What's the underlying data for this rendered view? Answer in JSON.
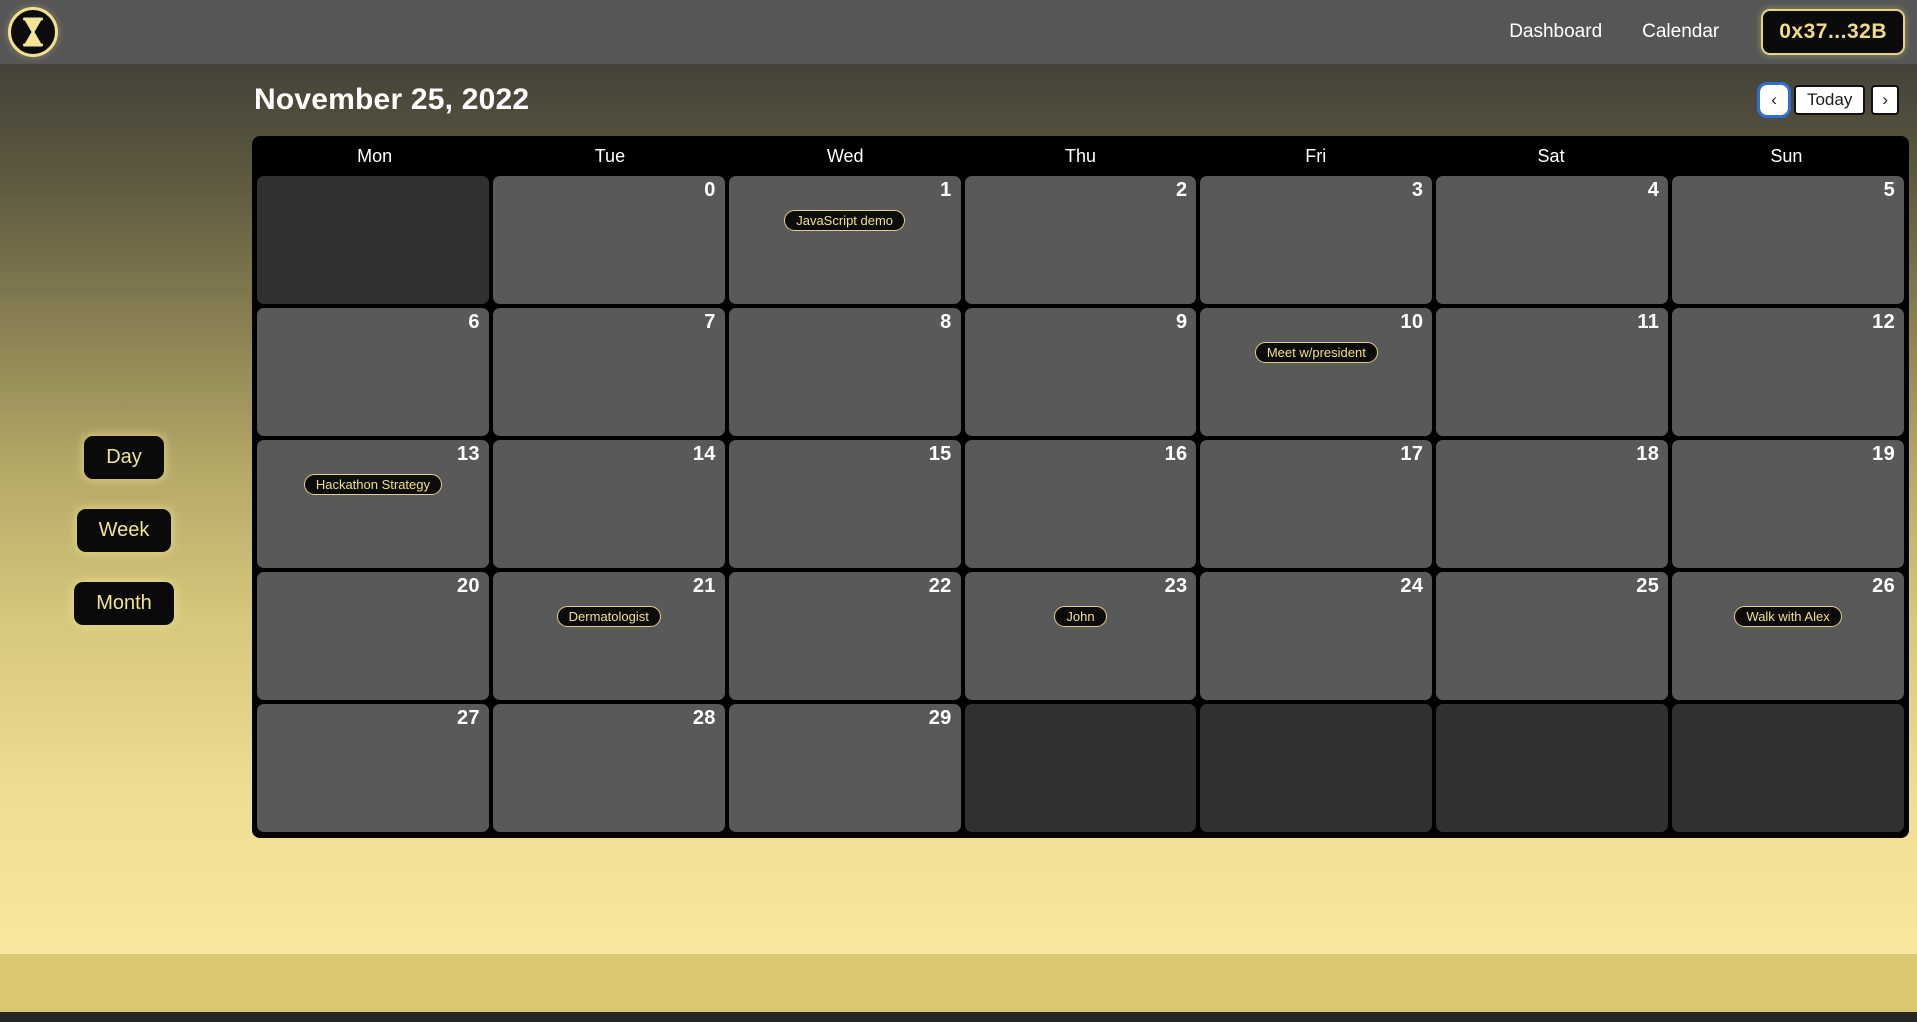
{
  "navbar": {
    "logo_icon": "hourglass-icon",
    "links": [
      {
        "label": "Dashboard"
      },
      {
        "label": "Calendar"
      }
    ],
    "wallet": {
      "label": "0x37...32B"
    }
  },
  "sidebar": {
    "view_buttons": [
      {
        "id": "day",
        "label": "Day"
      },
      {
        "id": "week",
        "label": "Week"
      },
      {
        "id": "month",
        "label": "Month"
      }
    ]
  },
  "calendar": {
    "title": "November 25, 2022",
    "controls": {
      "prev_label": "‹",
      "prev_icon": "chevron-left-icon",
      "today_label": "Today",
      "next_label": "›",
      "next_icon": "chevron-right-icon",
      "focused_control": "prev"
    },
    "weekdays": [
      "Mon",
      "Tue",
      "Wed",
      "Thu",
      "Fri",
      "Sat",
      "Sun"
    ],
    "weeks": [
      [
        {
          "num": "",
          "active": false,
          "events": []
        },
        {
          "num": "0",
          "active": true,
          "events": []
        },
        {
          "num": "1",
          "active": true,
          "events": [
            "JavaScript demo"
          ]
        },
        {
          "num": "2",
          "active": true,
          "events": []
        },
        {
          "num": "3",
          "active": true,
          "events": []
        },
        {
          "num": "4",
          "active": true,
          "events": []
        },
        {
          "num": "5",
          "active": true,
          "events": []
        }
      ],
      [
        {
          "num": "6",
          "active": true,
          "events": []
        },
        {
          "num": "7",
          "active": true,
          "events": []
        },
        {
          "num": "8",
          "active": true,
          "events": []
        },
        {
          "num": "9",
          "active": true,
          "events": []
        },
        {
          "num": "10",
          "active": true,
          "events": [
            "Meet w/president"
          ]
        },
        {
          "num": "11",
          "active": true,
          "events": []
        },
        {
          "num": "12",
          "active": true,
          "events": []
        }
      ],
      [
        {
          "num": "13",
          "active": true,
          "events": [
            "Hackathon Strategy"
          ]
        },
        {
          "num": "14",
          "active": true,
          "events": []
        },
        {
          "num": "15",
          "active": true,
          "events": []
        },
        {
          "num": "16",
          "active": true,
          "events": []
        },
        {
          "num": "17",
          "active": true,
          "events": []
        },
        {
          "num": "18",
          "active": true,
          "events": []
        },
        {
          "num": "19",
          "active": true,
          "events": []
        }
      ],
      [
        {
          "num": "20",
          "active": true,
          "events": []
        },
        {
          "num": "21",
          "active": true,
          "events": [
            "Dermatologist"
          ]
        },
        {
          "num": "22",
          "active": true,
          "events": []
        },
        {
          "num": "23",
          "active": true,
          "events": [
            "John"
          ]
        },
        {
          "num": "24",
          "active": true,
          "events": []
        },
        {
          "num": "25",
          "active": true,
          "events": []
        },
        {
          "num": "26",
          "active": true,
          "events": [
            "Walk with Alex"
          ]
        }
      ],
      [
        {
          "num": "27",
          "active": true,
          "events": []
        },
        {
          "num": "28",
          "active": true,
          "events": []
        },
        {
          "num": "29",
          "active": true,
          "events": []
        },
        {
          "num": "",
          "active": false,
          "events": []
        },
        {
          "num": "",
          "active": false,
          "events": []
        },
        {
          "num": "",
          "active": false,
          "events": []
        },
        {
          "num": "",
          "active": false,
          "events": []
        }
      ]
    ]
  },
  "colors": {
    "accent_gold": "#f2e08a",
    "navbar_bg": "#565656",
    "cell_active": "#595959",
    "cell_inactive": "#303030",
    "focus_ring": "#2f6fd0"
  }
}
